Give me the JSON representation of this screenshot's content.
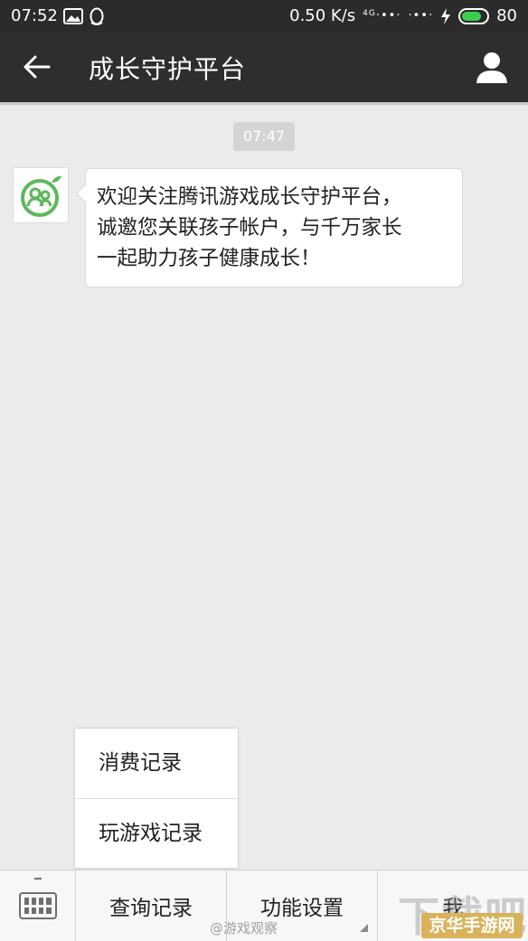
{
  "status_bar": {
    "time": "07:52",
    "speed": "0.50 K/s",
    "signal_1": "4G",
    "battery_level": "80",
    "battery_color": "#3ccf4e"
  },
  "title_bar": {
    "title": "成长守护平台",
    "back_icon": "arrow-left-icon",
    "profile_icon": "person-icon"
  },
  "chat": {
    "timestamp": "07:47",
    "message": {
      "lines": [
        "欢迎关注腾讯游戏成长守护平台，",
        "诚邀您关联孩子帐户，与千万家长",
        "一起助力孩子健康成长！"
      ]
    }
  },
  "popup_menu": {
    "items": [
      {
        "label": "消费记录"
      },
      {
        "label": "玩游戏记录"
      }
    ]
  },
  "bottom_menu": {
    "items": [
      {
        "label": "查询记录"
      },
      {
        "label": "功能设置"
      },
      {
        "label": "我"
      }
    ]
  },
  "watermarks": {
    "weibo": "@游戏观察",
    "logo": "下载吧",
    "site": "京华手游网"
  },
  "colors": {
    "title_bar_bg": "#2d2f2f",
    "chat_bg": "#ebebeb",
    "avatar_green": "#5cb85c"
  }
}
